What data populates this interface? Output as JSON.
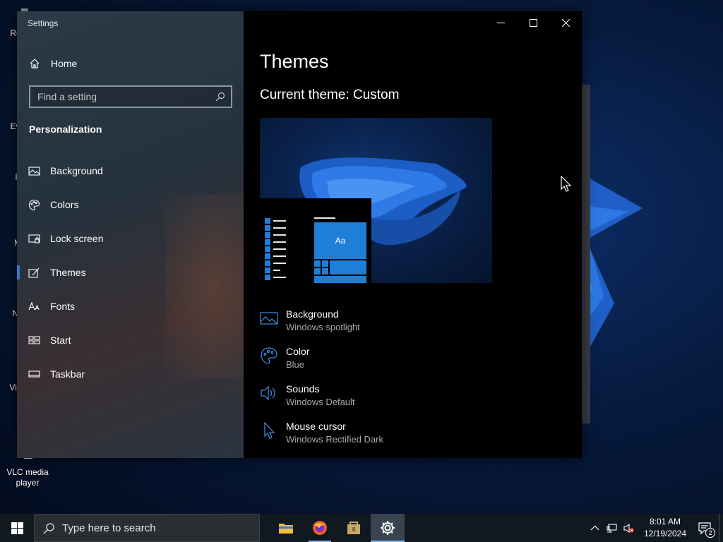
{
  "desktop": {
    "icons": [
      {
        "label": "Rec"
      },
      {
        "label": "Eve"
      },
      {
        "label": "F"
      },
      {
        "label": "M"
      },
      {
        "label": "No"
      },
      {
        "label": "Visu"
      },
      {
        "label": "VLC media player"
      }
    ]
  },
  "window": {
    "app_title": "Settings",
    "home_label": "Home",
    "search": {
      "placeholder": "Find a setting",
      "value": ""
    },
    "section_title": "Personalization",
    "nav_items": [
      {
        "label": "Background",
        "icon": "picture-icon"
      },
      {
        "label": "Colors",
        "icon": "palette-icon"
      },
      {
        "label": "Lock screen",
        "icon": "lock-screen-icon"
      },
      {
        "label": "Themes",
        "icon": "brush-icon",
        "active": true
      },
      {
        "label": "Fonts",
        "icon": "font-icon"
      },
      {
        "label": "Start",
        "icon": "start-icon"
      },
      {
        "label": "Taskbar",
        "icon": "taskbar-icon"
      }
    ],
    "page_title": "Themes",
    "current_theme": "Current theme: Custom",
    "preview": {
      "tile_text": "Aa"
    },
    "options": [
      {
        "name": "Background",
        "value": "Windows spotlight",
        "icon": "picture-icon"
      },
      {
        "name": "Color",
        "value": "Blue",
        "icon": "palette-icon"
      },
      {
        "name": "Sounds",
        "value": "Windows Default",
        "icon": "speaker-icon"
      },
      {
        "name": "Mouse cursor",
        "value": "Windows Rectified Dark",
        "icon": "cursor-icon"
      }
    ],
    "accent_color": "#1e7fd8"
  },
  "taskbar": {
    "search_placeholder": "Type here to search",
    "apps": [
      {
        "name": "File Explorer",
        "icon": "folder-icon"
      },
      {
        "name": "Firefox",
        "icon": "firefox-icon"
      },
      {
        "name": "Store",
        "icon": "package-icon"
      },
      {
        "name": "Settings",
        "icon": "gear-icon"
      }
    ],
    "time": "8:01 AM",
    "date": "12/19/2024",
    "notification_count": "2"
  }
}
